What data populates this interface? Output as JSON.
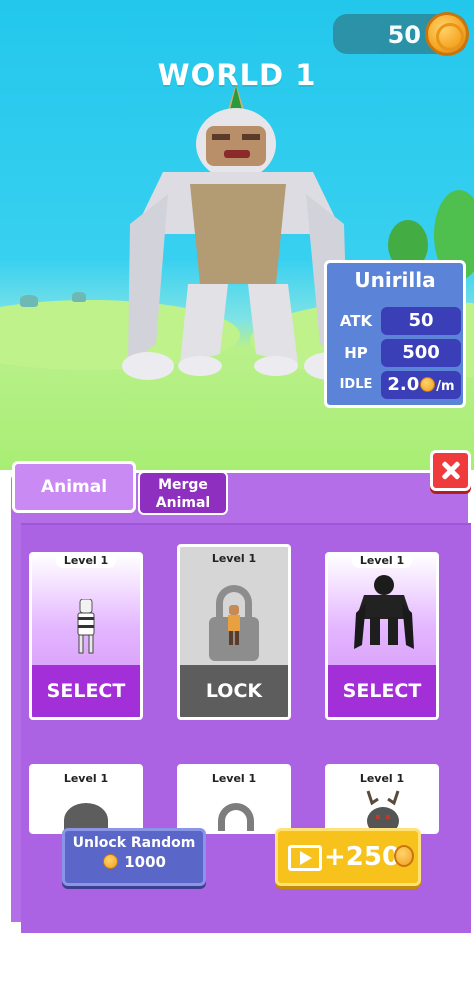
{
  "hud": {
    "coins": "50"
  },
  "world": {
    "title": "WORLD 1"
  },
  "animal_stats": {
    "name": "Unirilla",
    "rows": [
      {
        "label": "ATK",
        "value": "50"
      },
      {
        "label": "HP",
        "value": "500"
      },
      {
        "label": "IDLE",
        "value": "2.0",
        "unit": "/m"
      }
    ]
  },
  "tabs": [
    {
      "label": "Animal",
      "active": true
    },
    {
      "label": "Merge Animal",
      "active": false
    }
  ],
  "cards": [
    {
      "level": "Level 1",
      "action": "SELECT",
      "state": "unlocked",
      "icon": "zebra-figure-icon"
    },
    {
      "level": "Level 1",
      "action": "LOCK",
      "state": "locked",
      "icon": "padlock-icon"
    },
    {
      "level": "Level 1",
      "action": "SELECT",
      "state": "unlocked",
      "icon": "black-gorilla-icon"
    },
    {
      "level": "Level 1",
      "state": "partial",
      "icon": "boulder-creature-icon"
    },
    {
      "level": "Level 1",
      "state": "partial",
      "icon": "padlock-icon"
    },
    {
      "level": "Level 1",
      "state": "partial",
      "icon": "antlered-creature-icon"
    }
  ],
  "buttons": {
    "unlock_random": {
      "label": "Unlock Random",
      "cost": "1000"
    },
    "watch_ad": {
      "reward": "+250"
    }
  },
  "colors": {
    "panel": "#b46ee8",
    "select": "#a32fd9",
    "locked": "#5d5d5d",
    "stats_panel": "#5b84d8",
    "ad_button": "#f6c21b",
    "close": "#ef3b3b"
  }
}
